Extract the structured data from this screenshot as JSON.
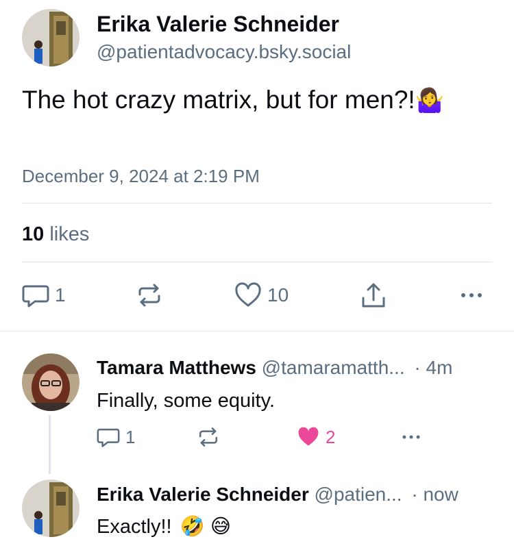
{
  "main_post": {
    "author_name": "Erika Valerie Schneider",
    "author_handle": "@patientadvocacy.bsky.social",
    "text": "The hot crazy matrix, but for men?!",
    "emoji": "🤷‍♀️",
    "timestamp": "December 9, 2024 at 2:19 PM",
    "likes_count": "10",
    "likes_label": "likes",
    "actions": {
      "replies": "1",
      "likes": "10"
    }
  },
  "replies": [
    {
      "author_name": "Tamara Matthews",
      "author_handle": "@tamaramatth...",
      "time": "· 4m",
      "text": "Finally, some equity.",
      "replies": "1",
      "likes": "2"
    },
    {
      "author_name": "Erika Valerie Schneider",
      "author_handle": "@patien...",
      "time": "· now",
      "text": "Exactly!!",
      "emojis": "🤣 😅"
    }
  ],
  "colors": {
    "text": "#0b0f14",
    "muted": "#5b6d80",
    "like_active": "#ec4899",
    "divider": "#dfe3e8"
  }
}
